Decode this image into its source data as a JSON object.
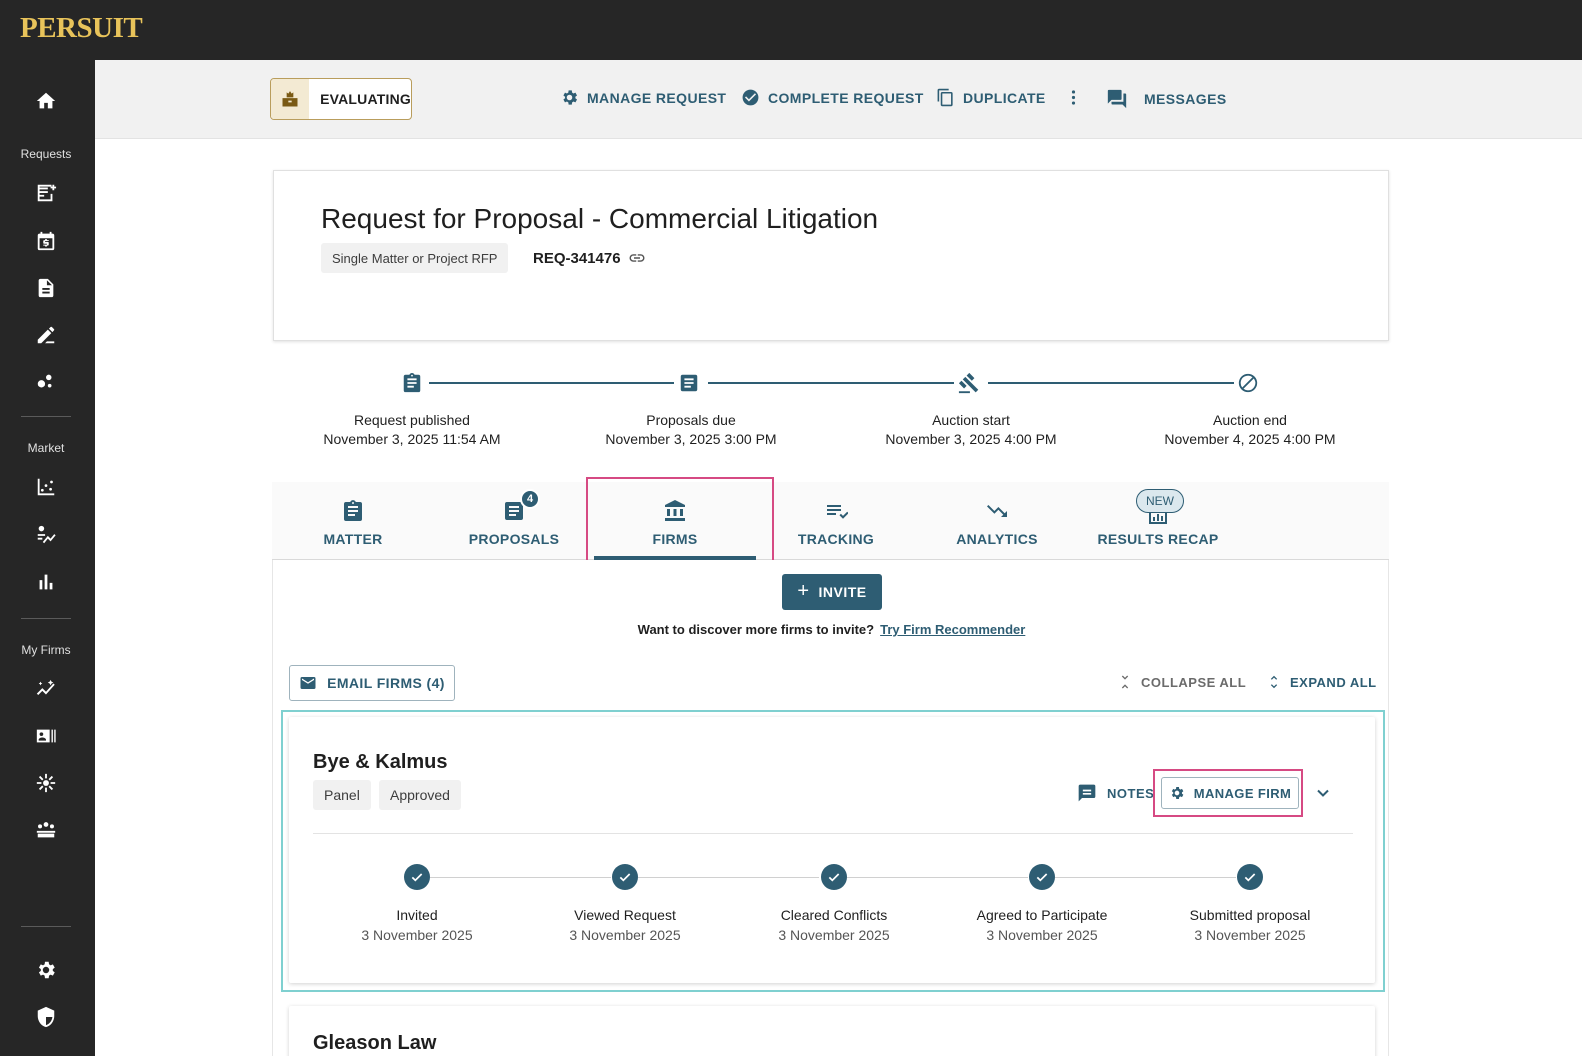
{
  "app": {
    "logo": "PERSUIT"
  },
  "sidebar": {
    "sections": [
      "Requests",
      "Market",
      "My Firms"
    ]
  },
  "toolbar": {
    "status": "EVALUATING",
    "actions": [
      "MANAGE REQUEST",
      "COMPLETE REQUEST",
      "DUPLICATE",
      "MESSAGES"
    ]
  },
  "request": {
    "title": "Request for Proposal - Commercial Litigation",
    "type": "Single Matter or Project RFP",
    "id": "REQ-341476"
  },
  "timeline": [
    {
      "label": "Request published",
      "date": "November 3, 2025 11:54 AM"
    },
    {
      "label": "Proposals due",
      "date": "November 3, 2025 3:00 PM"
    },
    {
      "label": "Auction start",
      "date": "November 3, 2025 4:00 PM"
    },
    {
      "label": "Auction end",
      "date": "November 4, 2025 4:00 PM"
    }
  ],
  "tabs": {
    "items": [
      "MATTER",
      "PROPOSALS",
      "FIRMS",
      "TRACKING",
      "ANALYTICS",
      "RESULTS RECAP"
    ],
    "proposals_badge": "4",
    "new_badge": "NEW"
  },
  "firms_panel": {
    "invite_label": "INVITE",
    "discover_text": "Want to discover more firms to invite?",
    "discover_link": "Try Firm Recommender",
    "email_label": "EMAIL FIRMS (4)",
    "collapse_label": "COLLAPSE ALL",
    "expand_label": "EXPAND ALL"
  },
  "firms": [
    {
      "name": "Bye & Kalmus",
      "chips": [
        "Panel",
        "Approved"
      ],
      "notes_label": "NOTES",
      "manage_label": "MANAGE FIRM",
      "progress": [
        {
          "label": "Invited",
          "date": "3 November 2025"
        },
        {
          "label": "Viewed Request",
          "date": "3 November 2025"
        },
        {
          "label": "Cleared Conflicts",
          "date": "3 November 2025"
        },
        {
          "label": "Agreed to Participate",
          "date": "3 November 2025"
        },
        {
          "label": "Submitted proposal",
          "date": "3 November 2025"
        }
      ]
    },
    {
      "name": "Gleason Law"
    }
  ],
  "colors": {
    "accent": "#2e5d73",
    "highlight": "#d64a83",
    "logo": "#e8c35a"
  }
}
